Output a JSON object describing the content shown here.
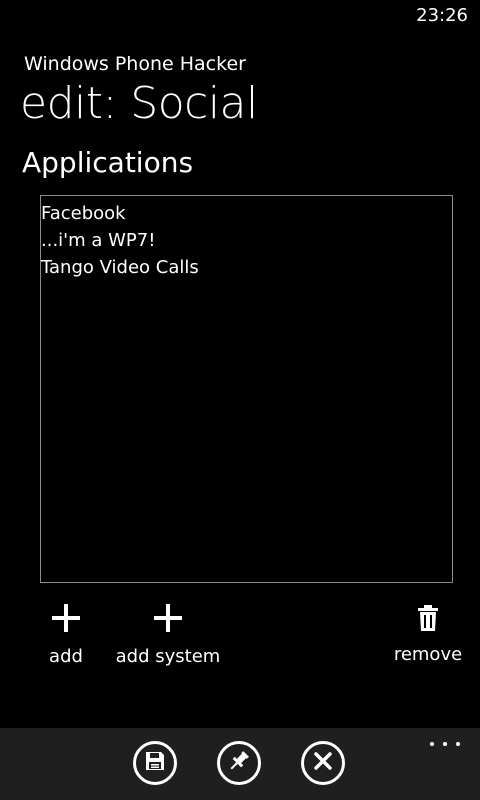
{
  "status_bar": {
    "time": "23:26"
  },
  "header": {
    "app_name": "Windows Phone Hacker",
    "page_title": "edit: Social"
  },
  "section": {
    "title": "Applications"
  },
  "applications": [
    "Facebook",
    "...i'm a WP7!",
    "Tango Video Calls"
  ],
  "actions": {
    "add_label": "add",
    "add_system_label": "add system",
    "remove_label": "remove"
  },
  "app_bar": {
    "buttons": [
      {
        "icon": "save-icon"
      },
      {
        "icon": "pin-icon"
      },
      {
        "icon": "cancel-icon"
      }
    ],
    "more_icon": "more-icon"
  },
  "colors": {
    "background": "#000000",
    "foreground": "#ffffff",
    "app_bar": "#1f1f1f",
    "list_border": "#8a8a8a"
  }
}
